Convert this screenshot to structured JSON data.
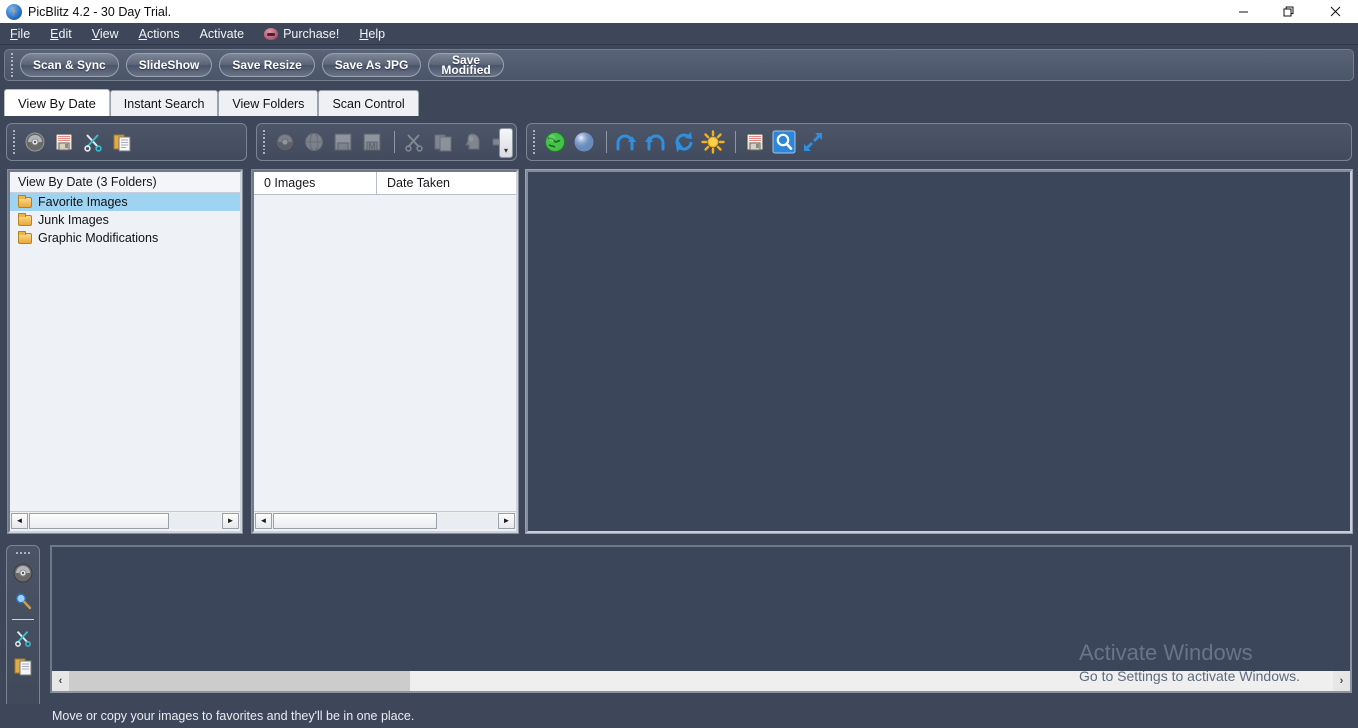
{
  "window": {
    "title": "PicBlitz 4.2  - 30 Day Trial.",
    "app_icon": "lightning-bolt-icon",
    "minimize_label": "—",
    "maximize_label": "❐",
    "close_label": "✕"
  },
  "menu": {
    "items": [
      {
        "label": "File",
        "accel": "F"
      },
      {
        "label": "Edit",
        "accel": "E"
      },
      {
        "label": "View",
        "accel": "V"
      },
      {
        "label": "Actions",
        "accel": "A"
      },
      {
        "label": "Activate",
        "accel": ""
      },
      {
        "label": "Purchase!",
        "accel": "",
        "icon": "piggy-bank-icon"
      },
      {
        "label": "Help",
        "accel": "H"
      }
    ]
  },
  "toolbar": {
    "buttons": [
      {
        "label": "Scan & Sync"
      },
      {
        "label": "SlideShow"
      },
      {
        "label": "Save Resize"
      },
      {
        "label": "Save As JPG"
      },
      {
        "label": "Save\nModified"
      }
    ]
  },
  "tabs": [
    {
      "label": "View By Date",
      "active": true
    },
    {
      "label": "Instant Search",
      "active": false
    },
    {
      "label": "View Folders",
      "active": false
    },
    {
      "label": "Scan Control",
      "active": false
    }
  ],
  "icon_toolbars": {
    "left": {
      "icons": [
        "disc-icon",
        "save-floppy-icon",
        "scissors-icon",
        "copy-paste-icon"
      ]
    },
    "middle": {
      "icons": [
        "disc-icon",
        "globe-icon",
        "save-floppy-icon",
        "save-modified-icon",
        "scissors-icon",
        "copy-icon",
        "head-profile-icon",
        "arrow-right-icon"
      ],
      "overflow": "chevron-down-icon"
    },
    "right": {
      "icons": [
        "globe-green-icon",
        "sphere-blue-icon",
        "rotate-right-icon",
        "rotate-left-icon",
        "flip-refresh-icon",
        "brightness-sun-icon",
        "save-floppy-icon",
        "zoom-search-icon",
        "resize-arrows-icon"
      ]
    }
  },
  "tree": {
    "header": "View By Date (3 Folders)",
    "items": [
      {
        "label": "Favorite Images",
        "selected": true
      },
      {
        "label": "Junk Images",
        "selected": false
      },
      {
        "label": "Graphic Modifications",
        "selected": false
      }
    ]
  },
  "list": {
    "columns": [
      "0 Images",
      "Date Taken"
    ],
    "rows": []
  },
  "vertical_toolbar": {
    "icons": [
      "disc-icon",
      "magnifier-icon",
      "scissors-icon",
      "copy-paste-icon"
    ]
  },
  "scrollbars": {
    "left_arrow": "◄",
    "right_arrow": "►",
    "filmstrip_left": "‹",
    "filmstrip_right": "›"
  },
  "status": {
    "text": "Move or copy your images to favorites and they'll be in one place."
  },
  "watermark": {
    "title": "Activate Windows",
    "subtitle": "Go to Settings to activate Windows."
  },
  "colors": {
    "window_bg": "#3d4759",
    "panel_bg": "#eef2f7",
    "selection": "#9fd3f2",
    "preview_bg": "#3c465a",
    "titlebar_bg": "#ffffff"
  }
}
